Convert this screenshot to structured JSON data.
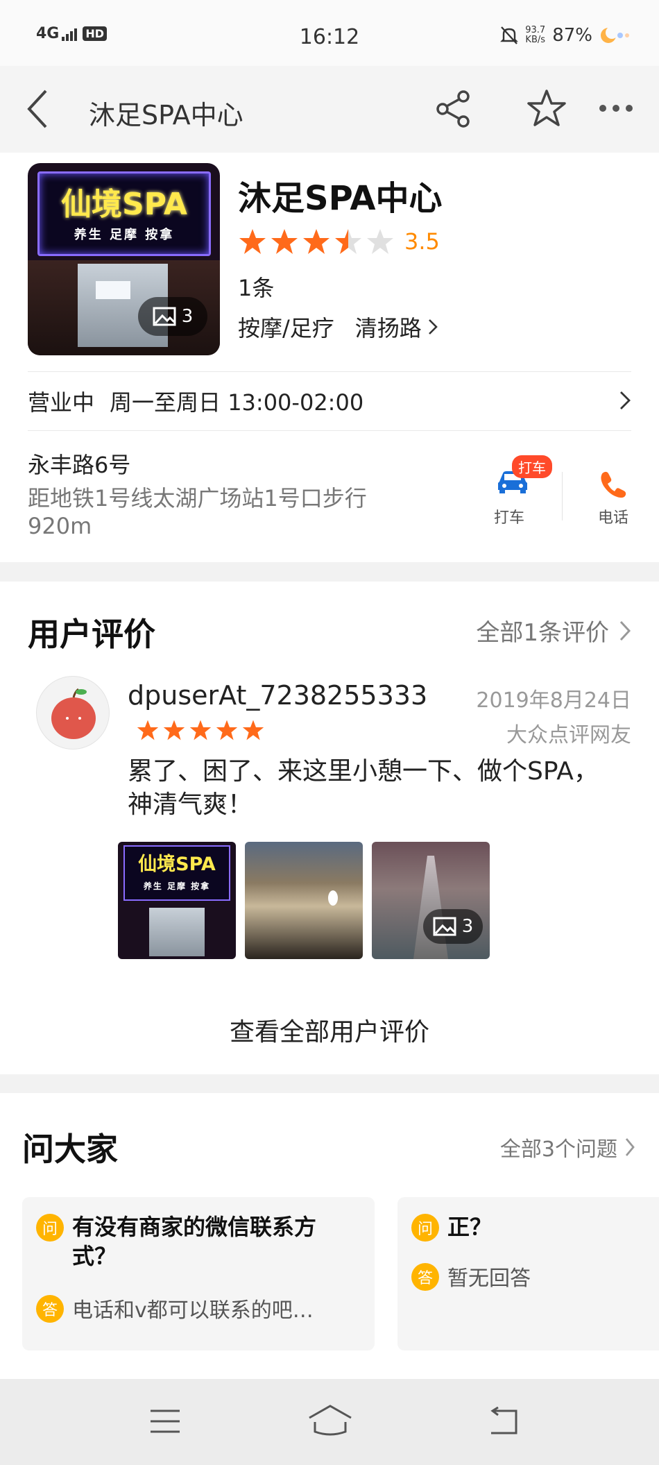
{
  "status_bar": {
    "signal": "4G",
    "hd": "HD",
    "time": "16:12",
    "net_speed_value": "93.7",
    "net_speed_unit": "KB/s",
    "battery": "87%"
  },
  "nav": {
    "title": "沐足SPA中心"
  },
  "shop": {
    "name": "沐足SPA中心",
    "rating": 3.5,
    "rating_text": "3.5",
    "review_count": "1条",
    "category": "按摩/足疗",
    "area": "清扬路",
    "photo_count": "3",
    "sign_text": "仙境SPA",
    "sign_subtext": "养生 足摩 按拿",
    "open_status": "营业中",
    "hours": "周一至周日 13:00-02:00",
    "address": "永丰路6号",
    "metro": "距地铁1号线太湖广场站1号口步行920m",
    "taxi_badge": "打车",
    "taxi_label": "打车",
    "phone_label": "电话"
  },
  "reviews": {
    "heading": "用户评价",
    "all_link": "全部1条评价",
    "item": {
      "user": "dpuserAt_7238255333",
      "stars": 5,
      "date": "2019年8月24日",
      "source": "大众点评网友",
      "text": "累了、困了、来这里小憩一下、做个SPA，神清气爽！",
      "photo_count": "3"
    },
    "see_all": "查看全部用户评价"
  },
  "qa": {
    "heading": "问大家",
    "all_link": "全部3个问题",
    "q_icon": "问",
    "a_icon": "答",
    "cards": [
      {
        "question": "有没有商家的微信联系方式？",
        "answer": "电话和v都可以联系的吧…"
      },
      {
        "question": "正？",
        "answer": "暂无回答"
      }
    ]
  },
  "colors": {
    "accent_orange": "#ff6a1a",
    "rating_orange": "#ff8a00",
    "qa_yellow": "#ffb400"
  }
}
